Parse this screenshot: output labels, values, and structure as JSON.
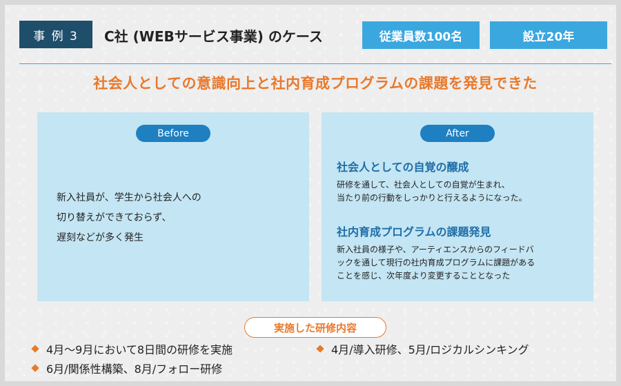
{
  "header": {
    "case_label": "事 例 3",
    "company_title": "C社 (WEBサービス事業) のケース",
    "employees": "従業員数100名",
    "founded": "設立20年"
  },
  "headline": "社会人としての意識向上と社内育成プログラムの課題を発見できた",
  "before": {
    "label": "Before",
    "lines": [
      "新入社員が、学生から社会人への",
      "切り替えができておらず、",
      "遅刻などが多く発生"
    ]
  },
  "after": {
    "label": "After",
    "items": [
      {
        "heading": "社会人としての自覚の醸成",
        "lines": [
          "研修を通して、社会人としての自覚が生まれ、",
          "当たり前の行動をしっかりと行えるようになった。"
        ]
      },
      {
        "heading": "社内育成プログラムの課題発見",
        "lines": [
          "新入社員の様子や、アーティエンスからのフィードバ",
          "ックを通して現行の社内育成プログラムに課題がある",
          "ことを感じ、次年度より変更することとなった"
        ]
      }
    ]
  },
  "training": {
    "label": "実施した研修内容",
    "items": [
      "4月～9月において8日間の研修を実施",
      "4月/導入研修、5月/ロジカルシンキング",
      "6月/関係性構築、8月/フォロー研修"
    ]
  },
  "colors": {
    "navy": "#1f4e6b",
    "blue": "#3aa7df",
    "orange": "#e8792b",
    "panel": "#c4e5f3"
  }
}
